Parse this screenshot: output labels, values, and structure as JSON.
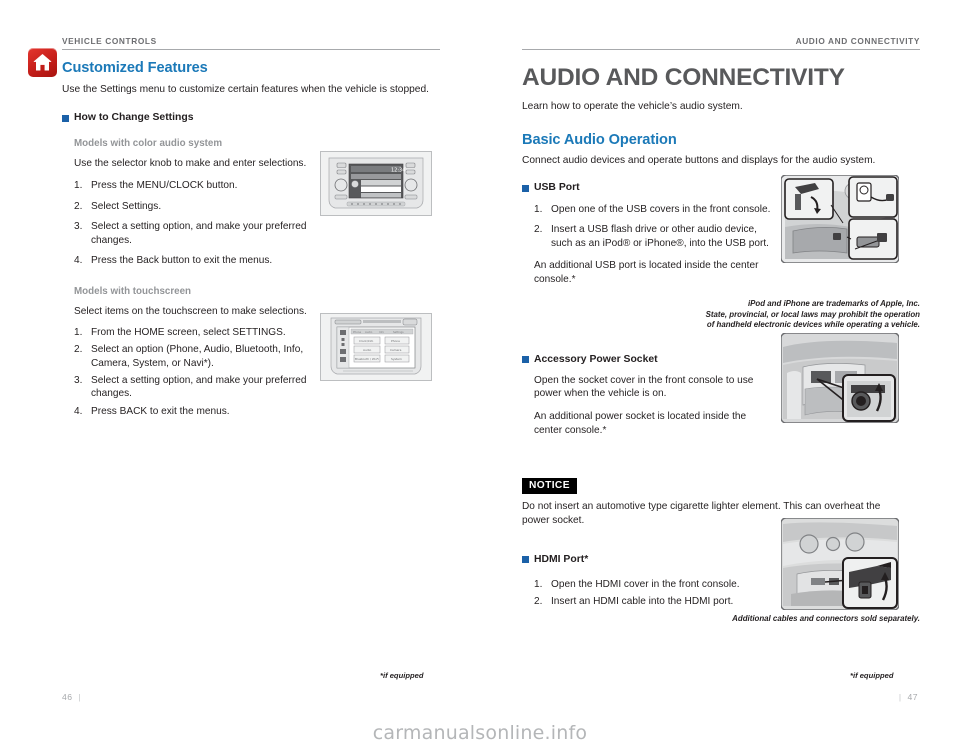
{
  "doc": {
    "watermark": "carmanualsonline.info"
  },
  "left_page": {
    "running_head": "VEHICLE CONTROLS",
    "tab_icon": "home-icon",
    "section_title": "Customized Features",
    "section_intro": "Use the Settings menu to customize certain features when the vehicle is stopped.",
    "subsection_title": "How to Change Settings",
    "group_color_audio": {
      "model_label": "Models with color audio system",
      "lead": "Use the selector knob to make and enter selections.",
      "steps": [
        {
          "num": "1.",
          "text": "Press the MENU/CLOCK button."
        },
        {
          "num": "2.",
          "text": "Select Settings."
        },
        {
          "num": "3.",
          "text": "Select a setting option, and make your preferred changes."
        },
        {
          "num": "4.",
          "text": "Press the Back button to exit the menus."
        }
      ],
      "figure_name": "color-audio-system-display-figure"
    },
    "group_touchscreen": {
      "model_label": "Models with touchscreen",
      "lead": "Select items on the touchscreen to make selections.",
      "steps": [
        {
          "num": "1.",
          "text": "From the HOME screen, select SETTINGS."
        },
        {
          "num": "2.",
          "text": "Select an option (Phone, Audio, Bluetooth, Info, Camera, System, or Navi*)."
        },
        {
          "num": "3.",
          "text": "Select a setting option, and make your preferred changes."
        },
        {
          "num": "4.",
          "text": "Press BACK to exit the menus."
        }
      ],
      "figure_name": "touchscreen-settings-display-figure"
    },
    "footnote": "*if equipped",
    "page_number": "46"
  },
  "right_page": {
    "running_head": "AUDIO AND CONNECTIVITY",
    "chapter_title": "AUDIO AND CONNECTIVITY",
    "chapter_intro": "Learn how to operate the vehicle’s audio system.",
    "section_title": "Basic Audio Operation",
    "section_intro": "Connect audio devices and operate buttons and displays for the audio system.",
    "usb_port": {
      "subsection_title": "USB Port",
      "steps": [
        {
          "num": "1.",
          "text": "Open one of the USB covers in the front console."
        },
        {
          "num": "2.",
          "text": "Insert a USB flash drive or other audio device, such as an iPod® or iPhone®, into the USB port."
        }
      ],
      "note": "An additional USB port is located inside the center console.*",
      "figure_name": "usb-port-front-console-figure",
      "trademark_lines": [
        "iPod and iPhone are trademarks of Apple, Inc.",
        "State, provincial, or local laws may prohibit the operation",
        "of handheld electronic devices while operating a vehicle."
      ]
    },
    "accessory_power_socket": {
      "subsection_title": "Accessory Power Socket",
      "paragraphs": [
        "Open the socket cover in the front console to use power when the vehicle is on.",
        "An additional power socket is located inside the center console.*"
      ],
      "figure_name": "accessory-power-socket-figure"
    },
    "notice": {
      "label": "NOTICE",
      "text": "Do not insert an automotive type cigarette lighter element. This can overheat the power socket."
    },
    "hdmi_port": {
      "subsection_title": "HDMI Port*",
      "steps": [
        {
          "num": "1.",
          "text": "Open the HDMI cover in the front console."
        },
        {
          "num": "2.",
          "text": "Insert an HDMI cable into the HDMI port."
        }
      ],
      "figure_name": "hdmi-port-front-console-figure",
      "caption": "Additional cables and connectors sold separately."
    },
    "footnote": "*if equipped",
    "page_number": "47"
  },
  "colors": {
    "heading_blue": "#1b79b8",
    "bullet_blue": "#1b61a8",
    "chapter_gray": "#58595b",
    "runhead_gray": "#6d6e71",
    "tab_red": "#c9211c",
    "model_label_gray": "#939598"
  }
}
